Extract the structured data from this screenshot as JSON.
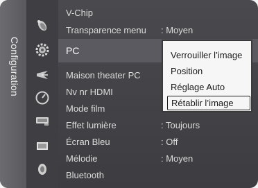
{
  "sidebar": {
    "label": "Configuration"
  },
  "menu": {
    "items": [
      {
        "label": "V-Chip",
        "value": ""
      },
      {
        "label": "Transparence menu",
        "value": ": Moyen"
      },
      {
        "label": "PC",
        "value": ""
      },
      {
        "label": "Maison theater PC",
        "value": ":"
      },
      {
        "label": "Nv nr HDMI",
        "value": ":"
      },
      {
        "label": "Mode film",
        "value": ":"
      },
      {
        "label": "Effet lumière",
        "value": ": Toujours"
      },
      {
        "label": "Écran Bleu",
        "value": ": Off"
      },
      {
        "label": "Mélodie",
        "value": ": Moyen"
      },
      {
        "label": "Bluetooth",
        "value": ""
      }
    ]
  },
  "submenu": {
    "items": [
      {
        "label": "Verrouiller l’image"
      },
      {
        "label": "Position"
      },
      {
        "label": "Réglage Auto"
      },
      {
        "label": "Rétablir l’image"
      }
    ],
    "selected_index": 3
  },
  "icons": [
    "satellite-dish-icon",
    "gear-icon",
    "antenna-icon",
    "clock-icon",
    "tv-input-icon",
    "screen-icon",
    "speaker-icon"
  ]
}
